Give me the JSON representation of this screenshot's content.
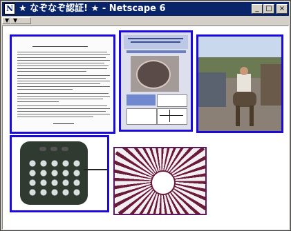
{
  "window": {
    "title": "★ なぞなぞ認証! ★ - Netscape 6",
    "app_icon_glyph": "N",
    "minimize_glyph": "_",
    "maximize_glyph": "□",
    "close_glyph": "×"
  },
  "toolbar": {
    "grips": [
      "collapse-grip-1",
      "collapse-grip-2"
    ]
  },
  "images": [
    {
      "name": "typewritten-letter-image",
      "description_icon": "document-icon"
    },
    {
      "name": "research-poster-image",
      "description_icon": "poster-icon"
    },
    {
      "name": "man-riding-donkey-photo",
      "description_icon": "photo-icon"
    },
    {
      "name": "keypad-device-image",
      "description_icon": "device-icon"
    },
    {
      "name": "radial-sunburst-image",
      "description_icon": "pattern-icon"
    }
  ],
  "colors": {
    "titlebar": "#0a246a",
    "frame_border": "#1a0adb",
    "chrome": "#d4d0c8"
  }
}
